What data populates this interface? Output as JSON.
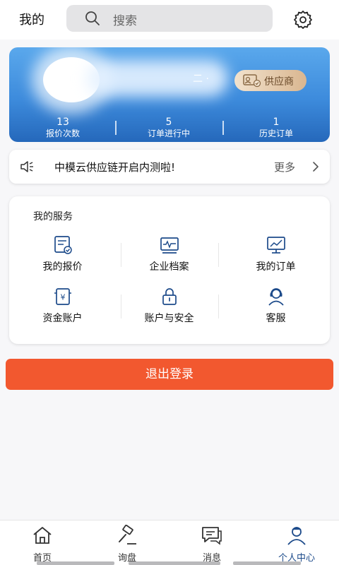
{
  "header": {
    "title": "我的",
    "search_placeholder": "搜索"
  },
  "profile": {
    "username": "二 ·",
    "role_badge": "供应商",
    "stats": [
      {
        "value": "13",
        "label": "报价次数"
      },
      {
        "value": "5",
        "label": "订单进行中"
      },
      {
        "value": "1",
        "label": "历史订单"
      }
    ]
  },
  "notice": {
    "text": "中模云供应链开启内测啦!",
    "more": "更多"
  },
  "services": {
    "title": "我的服务",
    "items": [
      {
        "label": "我的报价",
        "icon": "quote-icon"
      },
      {
        "label": "企业档案",
        "icon": "company-file-icon"
      },
      {
        "label": "我的订单",
        "icon": "orders-chart-icon"
      },
      {
        "label": "资金账户",
        "icon": "wallet-icon"
      },
      {
        "label": "账户与安全",
        "icon": "lock-icon"
      },
      {
        "label": "客服",
        "icon": "customer-service-icon"
      }
    ]
  },
  "logout_label": "退出登录",
  "bottom_nav": [
    {
      "label": "首页",
      "icon": "home-icon"
    },
    {
      "label": "询盘",
      "icon": "gavel-icon"
    },
    {
      "label": "消息",
      "icon": "message-icon"
    },
    {
      "label": "个人中心",
      "icon": "user-icon",
      "active": true
    }
  ],
  "colors": {
    "accent_blue": "#3d8bdc",
    "logout_red": "#f2582f",
    "icon_navy": "#1c4a8a",
    "badge_gold": "#d9b690"
  }
}
